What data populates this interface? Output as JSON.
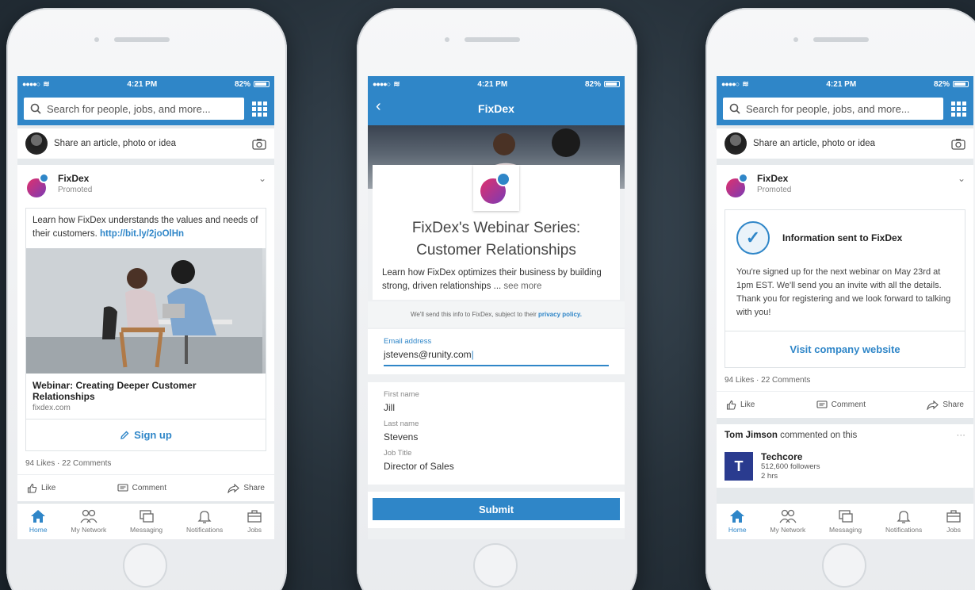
{
  "status": {
    "time": "4:21 PM",
    "battery": "82%"
  },
  "search": {
    "placeholder": "Search for people, jobs, and more..."
  },
  "share": {
    "prompt": "Share an article, photo or idea"
  },
  "post": {
    "company": "FixDex",
    "promoted": "Promoted",
    "text": "Learn how FixDex understands the values and needs of their customers.",
    "link": "http://bit.ly/2joOlHn",
    "ad_title": "Webinar: Creating Deeper Customer Relationships",
    "ad_url": "fixdex.com",
    "signup": "Sign up",
    "stats": "94 Likes · 22 Comments",
    "like": "Like",
    "comment": "Comment",
    "share": "Share"
  },
  "tabs": [
    "Home",
    "My Network",
    "Messaging",
    "Notifications",
    "Jobs"
  ],
  "form": {
    "nav_title": "FixDex",
    "title_line1": "FixDex's Webinar Series:",
    "title_line2": "Customer Relationships",
    "description": "Learn how FixDex optimizes their business by building strong, driven relationships ...",
    "see_more": "see more",
    "privacy_prefix": "We'll send this info to FixDex, subject to their",
    "privacy_link": "privacy policy.",
    "email_label": "Email address",
    "email_value": "jstevens@runity.com",
    "first_name_label": "First name",
    "first_name": "Jill",
    "last_name_label": "Last name",
    "last_name": "Stevens",
    "job_title_label": "Job Title",
    "job_title": "Director of Sales",
    "submit": "Submit"
  },
  "confirm": {
    "title": "Information sent to FixDex",
    "text": "You're signed up for the next webinar on May 23rd at 1pm EST. We'll send you an invite with all the details. Thank you for registering and we look forward to talking with you!",
    "visit": "Visit company website"
  },
  "activity": {
    "commenter": "Tom Jimson",
    "action": "commented on this",
    "more": "···",
    "company": "Techcore",
    "company_initial": "T",
    "followers": "512,600 followers",
    "age": "2 hrs"
  },
  "colors": {
    "brand_blue": "#2f86c8",
    "background": "#27323b"
  }
}
